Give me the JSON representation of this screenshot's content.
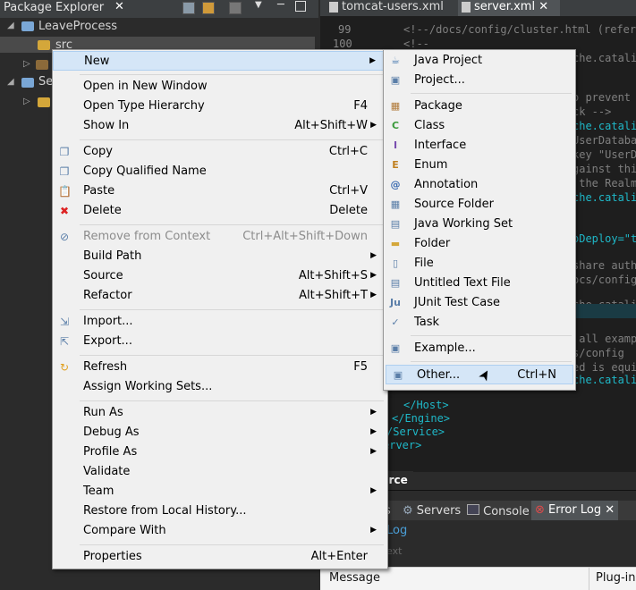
{
  "package_explorer": {
    "title": "Package Explorer",
    "close": "✕",
    "tree": [
      {
        "label": "LeaveProcess"
      },
      {
        "label": "src"
      },
      {
        "label": ""
      },
      {
        "label": "Se"
      },
      {
        "label": ""
      }
    ]
  },
  "editor": {
    "tabs": [
      {
        "label": "tomcat-users.xml"
      },
      {
        "label": "server.xml ✕"
      }
    ],
    "line_numbers": [
      "99",
      "100"
    ],
    "code_lines": [
      {
        "text": "<!--/docs/config/cluster.html (referen"
      },
      {
        "text": "<!--"
      },
      {
        "text": "che.catalin"
      },
      {
        "text": "o prevent"
      },
      {
        "text": "ck -->"
      },
      {
        "text": "che.catalina"
      },
      {
        "text": "UserDataba"
      },
      {
        "text": "key \"UserD"
      },
      {
        "text": "gainst thi"
      },
      {
        "text": " the Realm"
      },
      {
        "text": "che.catalin"
      },
      {
        "text": "oDeploy=\"t"
      },
      {
        "text": "share auth"
      },
      {
        "text": "ocs/config"
      },
      {
        "text": "che.catalin"
      },
      {
        "text": " all examp"
      },
      {
        "text": "s/config"
      },
      {
        "text": "ed is equi"
      },
      {
        "text": "che.catali"
      },
      {
        "text": "</Host>"
      },
      {
        "text": "</Engine>"
      },
      {
        "text": "/Service>"
      },
      {
        "text": "erver>"
      }
    ],
    "source_tab": "urce"
  },
  "bottom_panel": {
    "tabs": [
      {
        "label": "s"
      },
      {
        "label": "Servers"
      },
      {
        "label": "Console"
      },
      {
        "label": "Error Log ✕"
      }
    ],
    "sub_label": "Log",
    "filter_label": "ext",
    "columns": [
      "Message",
      "Plug-in"
    ]
  },
  "context_menu": {
    "items": [
      {
        "label": "New",
        "shortcut": "",
        "submenu": true,
        "icon": ""
      },
      {
        "label": "Open in New Window",
        "shortcut": "",
        "submenu": false,
        "icon": ""
      },
      {
        "label": "Open Type Hierarchy",
        "shortcut": "F4",
        "submenu": false,
        "icon": ""
      },
      {
        "label": "Show In",
        "shortcut": "Alt+Shift+W",
        "submenu": true,
        "icon": ""
      },
      {
        "label": "Copy",
        "shortcut": "Ctrl+C",
        "submenu": false,
        "icon": "copy-icon"
      },
      {
        "label": "Copy Qualified Name",
        "shortcut": "",
        "submenu": false,
        "icon": "copy-qualified-icon"
      },
      {
        "label": "Paste",
        "shortcut": "Ctrl+V",
        "submenu": false,
        "icon": "paste-icon"
      },
      {
        "label": "Delete",
        "shortcut": "Delete",
        "submenu": false,
        "icon": "delete-icon"
      },
      {
        "label": "Remove from Context",
        "shortcut": "Ctrl+Alt+Shift+Down",
        "submenu": false,
        "icon": "remove-context-icon",
        "disabled": true
      },
      {
        "label": "Build Path",
        "shortcut": "",
        "submenu": true,
        "icon": ""
      },
      {
        "label": "Source",
        "shortcut": "Alt+Shift+S",
        "submenu": true,
        "icon": ""
      },
      {
        "label": "Refactor",
        "shortcut": "Alt+Shift+T",
        "submenu": true,
        "icon": ""
      },
      {
        "label": "Import...",
        "shortcut": "",
        "submenu": false,
        "icon": "import-icon"
      },
      {
        "label": "Export...",
        "shortcut": "",
        "submenu": false,
        "icon": "export-icon"
      },
      {
        "label": "Refresh",
        "shortcut": "F5",
        "submenu": false,
        "icon": "refresh-icon"
      },
      {
        "label": "Assign Working Sets...",
        "shortcut": "",
        "submenu": false,
        "icon": ""
      },
      {
        "label": "Run As",
        "shortcut": "",
        "submenu": true,
        "icon": ""
      },
      {
        "label": "Debug As",
        "shortcut": "",
        "submenu": true,
        "icon": ""
      },
      {
        "label": "Profile As",
        "shortcut": "",
        "submenu": true,
        "icon": ""
      },
      {
        "label": "Validate",
        "shortcut": "",
        "submenu": false,
        "icon": ""
      },
      {
        "label": "Team",
        "shortcut": "",
        "submenu": true,
        "icon": ""
      },
      {
        "label": "Restore from Local History...",
        "shortcut": "",
        "submenu": false,
        "icon": ""
      },
      {
        "label": "Compare With",
        "shortcut": "",
        "submenu": true,
        "icon": ""
      },
      {
        "label": "Properties",
        "shortcut": "Alt+Enter",
        "submenu": false,
        "icon": ""
      }
    ]
  },
  "new_submenu": {
    "items": [
      {
        "label": "Java Project",
        "shortcut": "",
        "icon": "java-project-icon"
      },
      {
        "label": "Project...",
        "shortcut": "",
        "icon": "project-icon"
      },
      {
        "label": "Package",
        "shortcut": "",
        "icon": "package-icon"
      },
      {
        "label": "Class",
        "shortcut": "",
        "icon": "class-icon"
      },
      {
        "label": "Interface",
        "shortcut": "",
        "icon": "interface-icon"
      },
      {
        "label": "Enum",
        "shortcut": "",
        "icon": "enum-icon"
      },
      {
        "label": "Annotation",
        "shortcut": "",
        "icon": "annotation-icon"
      },
      {
        "label": "Source Folder",
        "shortcut": "",
        "icon": "source-folder-icon"
      },
      {
        "label": "Java Working Set",
        "shortcut": "",
        "icon": "working-set-icon"
      },
      {
        "label": "Folder",
        "shortcut": "",
        "icon": "folder-icon"
      },
      {
        "label": "File",
        "shortcut": "",
        "icon": "file-icon"
      },
      {
        "label": "Untitled Text File",
        "shortcut": "",
        "icon": "text-file-icon"
      },
      {
        "label": "JUnit Test Case",
        "shortcut": "",
        "icon": "junit-icon"
      },
      {
        "label": "Task",
        "shortcut": "",
        "icon": "task-icon"
      },
      {
        "label": "Example...",
        "shortcut": "",
        "icon": "example-icon"
      },
      {
        "label": "Other...",
        "shortcut": "Ctrl+N",
        "icon": "other-icon"
      }
    ]
  },
  "colors": {
    "menu_bg": "#f0f0f0",
    "menu_highlight": "#d5e6f7",
    "editor_bg": "#1e1e1e",
    "keyword_teal": "#1fb8c8",
    "comment_gray": "#7f7f7f"
  }
}
